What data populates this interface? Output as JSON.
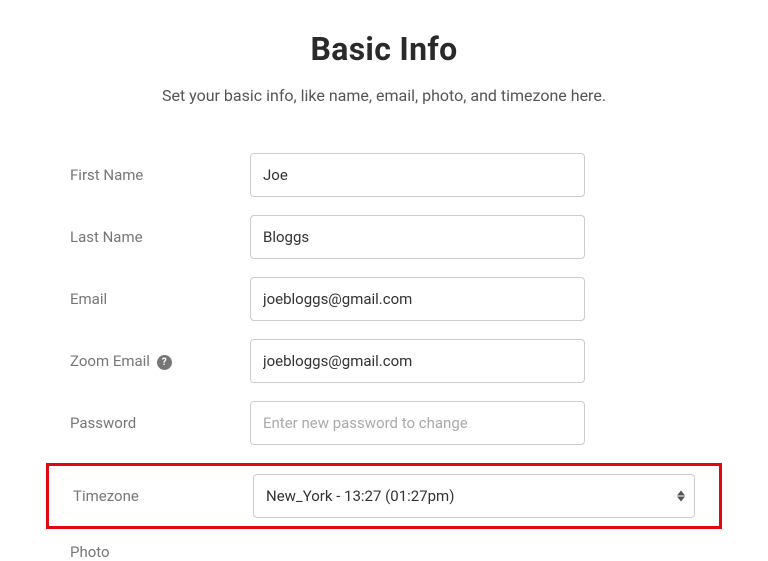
{
  "header": {
    "title": "Basic Info",
    "subtitle": "Set your basic info, like name, email, photo, and timezone here."
  },
  "form": {
    "first_name": {
      "label": "First Name",
      "value": "Joe"
    },
    "last_name": {
      "label": "Last Name",
      "value": "Bloggs"
    },
    "email": {
      "label": "Email",
      "value": "joebloggs@gmail.com"
    },
    "zoom_email": {
      "label": "Zoom Email",
      "value": "joebloggs@gmail.com",
      "help_icon": "?"
    },
    "password": {
      "label": "Password",
      "placeholder": "Enter new password to change"
    },
    "timezone": {
      "label": "Timezone",
      "selected": "New_York - 13:27 (01:27pm)"
    },
    "photo": {
      "label": "Photo"
    }
  }
}
